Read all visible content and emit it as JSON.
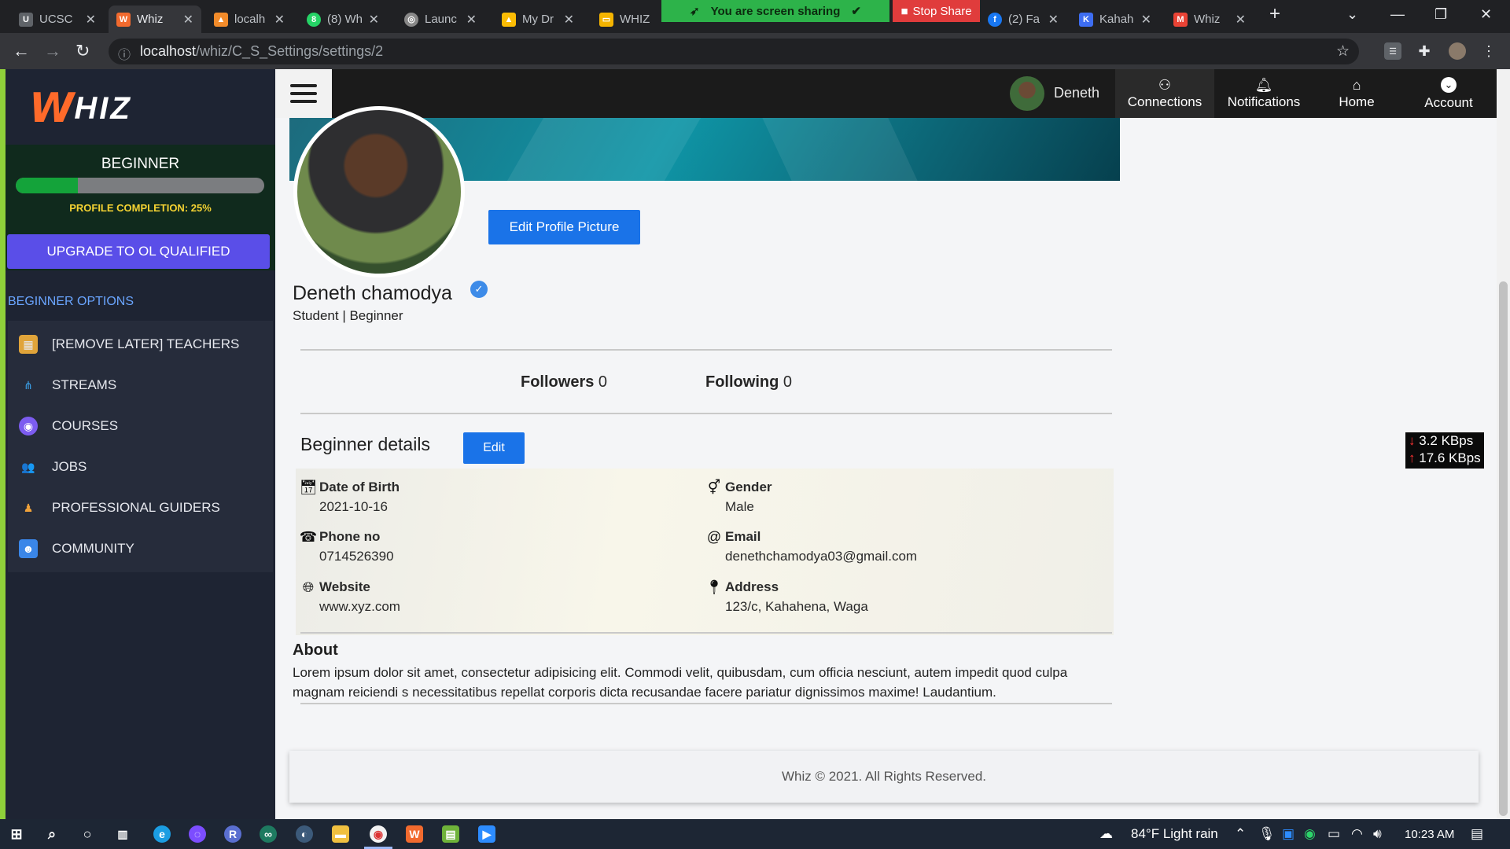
{
  "browser": {
    "tabs": [
      {
        "title": "UCSC",
        "icon": "ucsc-favicon-icon",
        "color": "#666666"
      },
      {
        "title": "Whiz",
        "icon": "whiz-favicon-icon",
        "color": "#f26a2e"
      },
      {
        "title": "localh",
        "icon": "xampp-favicon-icon",
        "color": "#f28b2a"
      },
      {
        "title": "(8) Wh",
        "icon": "whatsapp-favicon-icon",
        "color": "#25d366"
      },
      {
        "title": "Launc",
        "icon": "globe-favicon-icon",
        "color": "#888888"
      },
      {
        "title": "My Dr",
        "icon": "google-drive-favicon-icon",
        "color": "#fbbc04"
      },
      {
        "title": "WHIZ",
        "icon": "slides-favicon-icon",
        "color": "#f4b400"
      },
      {
        "title": "(2) Fa",
        "icon": "facebook-favicon-icon",
        "color": "#1877f2"
      },
      {
        "title": "Kahah",
        "icon": "kahoot-favicon-icon",
        "color": "#3d6df2"
      },
      {
        "title": "Whiz",
        "icon": "gmail-favicon-icon",
        "color": "#ea4335"
      }
    ],
    "sharing_text": "You are screen sharing",
    "stop_share": "Stop Share",
    "url_host": "localhost",
    "url_path": "/whiz/C_S_Settings/settings/2"
  },
  "sidebar": {
    "logo_w": "W",
    "logo_rest": "HIZ",
    "level": "BEGINNER",
    "profile_completion": 0.25,
    "completion_text": "PROFILE COMPLETION: 25%",
    "upgrade_label": "UPGRADE TO OL QUALIFIED",
    "options_heading": "BEGINNER OPTIONS",
    "items": [
      {
        "label": "[REMOVE LATER] TEACHERS",
        "icon": "teachers-icon"
      },
      {
        "label": "STREAMS",
        "icon": "streams-icon"
      },
      {
        "label": "COURSES",
        "icon": "courses-icon"
      },
      {
        "label": "JOBS",
        "icon": "jobs-icon"
      },
      {
        "label": "PROFESSIONAL GUIDERS",
        "icon": "guiders-icon"
      },
      {
        "label": "COMMUNITY",
        "icon": "community-icon"
      }
    ]
  },
  "topnav": {
    "user_name": "Deneth",
    "links": [
      {
        "label": "Connections",
        "icon": "people-icon"
      },
      {
        "label": "Notifications",
        "icon": "bell-icon"
      },
      {
        "label": "Home",
        "icon": "home-icon"
      },
      {
        "label": "Account",
        "icon": "chevron-down-icon"
      }
    ]
  },
  "profile": {
    "edit_picture_label": "Edit Profile Picture",
    "name": "Deneth chamodya",
    "role": "Student | Beginner",
    "followers_label": "Followers",
    "followers_count": "0",
    "following_label": "Following",
    "following_count": "0"
  },
  "details": {
    "title": "Beginner details",
    "edit_label": "Edit",
    "dob_label": "Date of Birth",
    "dob": "2021-10-16",
    "gender_label": "Gender",
    "gender": "Male",
    "phone_label": "Phone no",
    "phone": "0714526390",
    "email_label": "Email",
    "email": "denethchamodya03@gmail.com",
    "website_label": "Website",
    "website": "www.xyz.com",
    "address_label": "Address",
    "address": "123/c, Kahahena, Waga"
  },
  "about": {
    "title": "About",
    "text": "Lorem ipsum dolor sit amet, consectetur adipisicing elit. Commodi velit, quibusdam, cum officia nesciunt, autem impedit quod culpa magnam reiciendi s necessitatibus repellat corporis dicta recusandae facere pariatur dignissimos maxime! Laudantium."
  },
  "footer": {
    "text": "Whiz © 2021. All Rights Reserved."
  },
  "netspeed": {
    "down": "3.2 KBps",
    "up": "17.6 KBps"
  },
  "taskbar": {
    "weather": "84°F  Light rain",
    "time": "10:23 AM"
  }
}
